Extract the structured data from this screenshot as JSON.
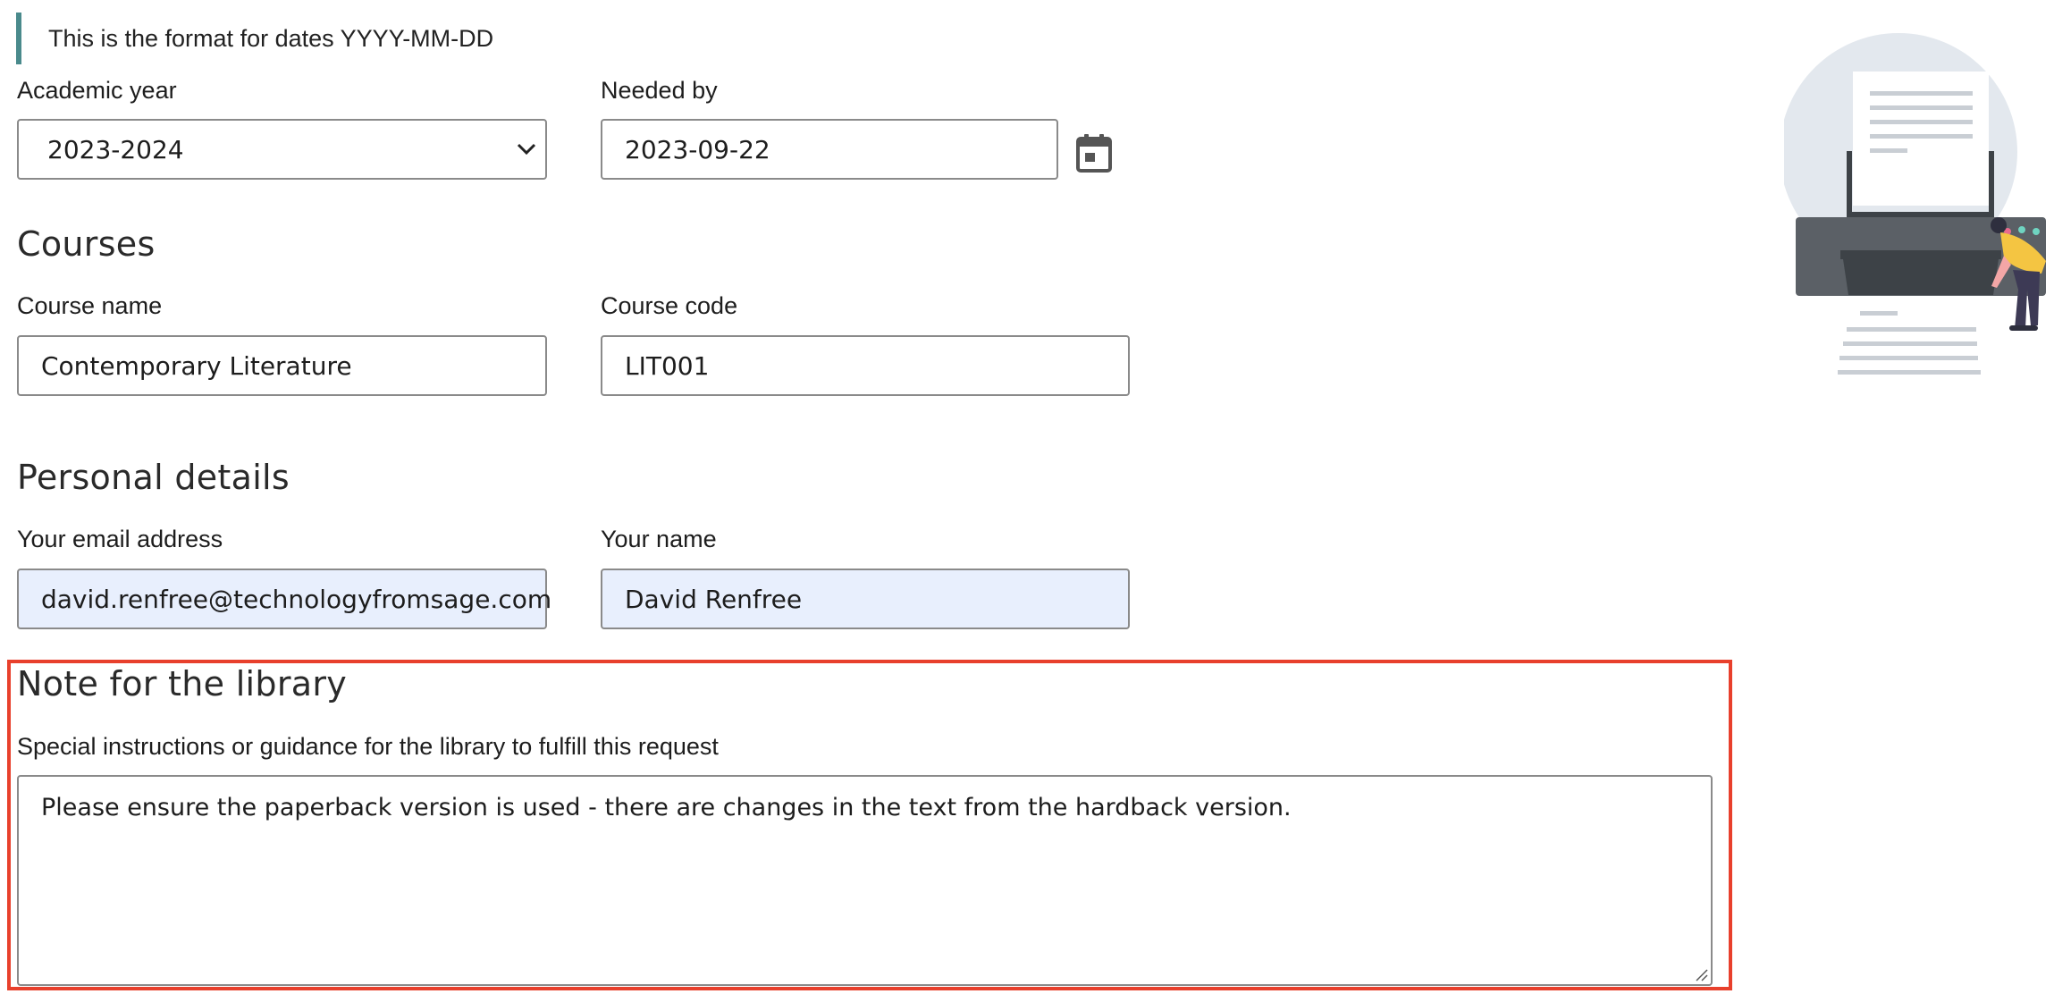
{
  "banner": {
    "text": "This is the format for dates YYYY-MM-DD"
  },
  "academic_year": {
    "label": "Academic year",
    "value": "2023-2024"
  },
  "needed_by": {
    "label": "Needed by",
    "value": "2023-09-22"
  },
  "courses": {
    "title": "Courses",
    "course_name": {
      "label": "Course name",
      "value": "Contemporary Literature"
    },
    "course_code": {
      "label": "Course code",
      "value": "LIT001"
    }
  },
  "personal": {
    "title": "Personal details",
    "email": {
      "label": "Your email address",
      "value": "david.renfree@technologyfromsage.com"
    },
    "name": {
      "label": "Your name",
      "value": "David Renfree"
    }
  },
  "note": {
    "title": "Note for the library",
    "label": "Special instructions or guidance for the library to fulfill this request",
    "value": "Please ensure the paperback version is used - there are changes in the text from the hardback version."
  },
  "icons": {
    "calendar": "calendar-icon",
    "dropdown": "chevron-down-icon",
    "illustration": "printer-illustration"
  },
  "colors": {
    "highlight_border": "#e8402c",
    "banner_accent": "#4a8a8c",
    "autofill_bg": "#e8effd"
  }
}
